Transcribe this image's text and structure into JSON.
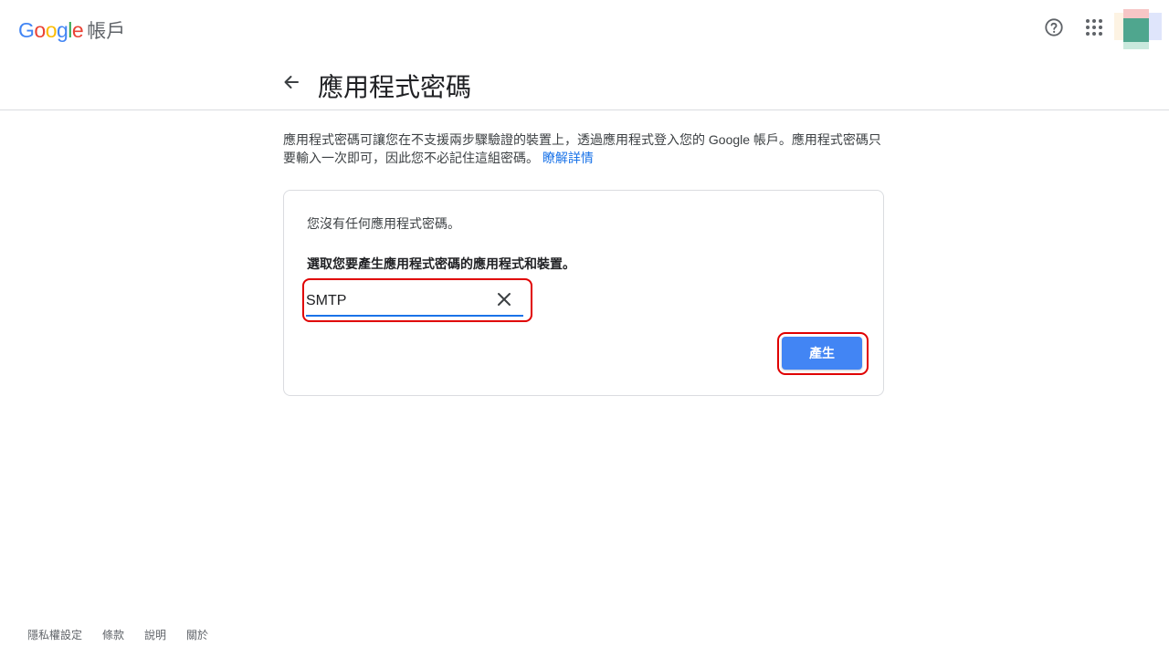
{
  "header": {
    "logo_letters": [
      "G",
      "o",
      "o",
      "g",
      "l",
      "e"
    ],
    "logo_product": "帳戶",
    "help_icon": "help-circle-icon",
    "apps_icon": "apps-grid-icon"
  },
  "page": {
    "title": "應用程式密碼",
    "back_icon": "arrow-back-icon"
  },
  "description": {
    "text": "應用程式密碼可讓您在不支援兩步驟驗證的裝置上，透過應用程式登入您的 Google 帳戶。應用程式密碼只要輸入一次即可，因此您不必記住這組密碼。",
    "link": "瞭解詳情"
  },
  "card": {
    "empty_message": "您沒有任何應用程式密碼。",
    "select_prompt": "選取您要產生應用程式密碼的應用程式和裝置。",
    "app_input_value": "SMTP",
    "clear_icon": "close-icon",
    "generate_label": "產生"
  },
  "footer": {
    "links": [
      "隱私權設定",
      "條款",
      "說明",
      "關於"
    ]
  },
  "colors": {
    "accent": "#1a73e8",
    "button": "#4285f4",
    "highlight": "#e00000"
  }
}
